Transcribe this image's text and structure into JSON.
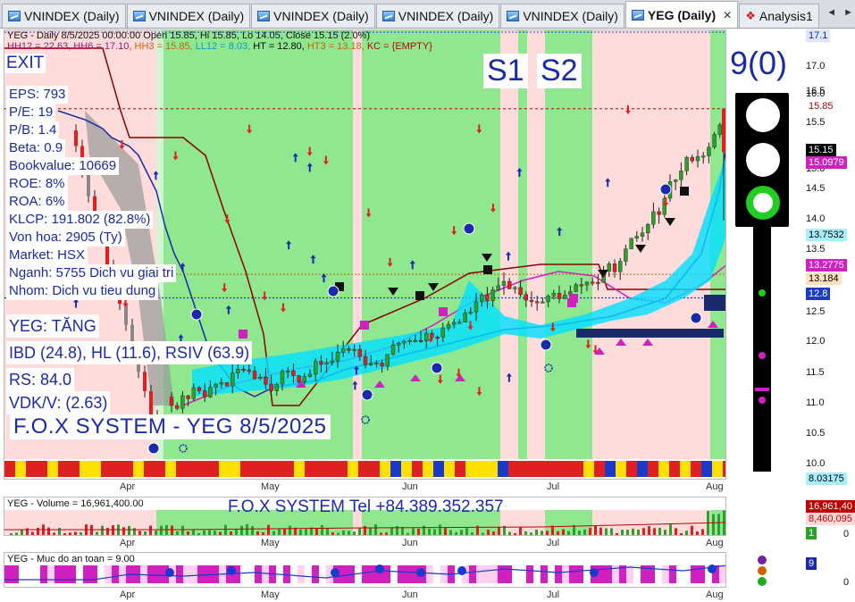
{
  "tabs": [
    {
      "label": "VNINDEX (Daily)",
      "active": false
    },
    {
      "label": "VNINDEX (Daily)",
      "active": false
    },
    {
      "label": "VNINDEX (Daily)",
      "active": false
    },
    {
      "label": "VNINDEX (Daily)",
      "active": false
    },
    {
      "label": "VNINDEX (Daily)",
      "active": false
    },
    {
      "label": "YEG (Daily)",
      "active": true
    },
    {
      "label": "Analysis1",
      "active": false
    }
  ],
  "tab_nav": {
    "left": "◄",
    "right": "►",
    "close": "✕"
  },
  "header": {
    "line1": "YEG - Daily 8/5/2025 00:00:00 Open 15.85, Hi 15.85, Lo 14.05, Close 15.15 (2.0%)",
    "hh12": "HH12 = 22.63,",
    "hh6": " HH6 = 17.10,",
    "hh3": " HH3 = 15.85,",
    "ll12": " LL12 = 8.03,",
    "ht": " HT  = 12.80,",
    "ht3": " HT3 = 13.18,",
    "kc": " KC = {EMPTY}"
  },
  "exit_label": "EXIT",
  "fundamentals": [
    "EPS: 793",
    "P/E: 19",
    "P/B: 1.4",
    "Beta: 0.9",
    "Bookvalue: 10669",
    "ROE: 8%",
    "ROA: 6%",
    "KLCP: 191.802 (82.8%)",
    "Von hoa: 2905 (Ty)",
    "Market: HSX",
    "Nganh: 5755 Dich vu giai tri",
    "Nhom: Dich vu tieu dung"
  ],
  "status": {
    "trend": "YEG: TĂNG",
    "ibd": "IBD (24.8), HL (11.6), RSIV (63.9)",
    "rs": "RS: 84.0",
    "vdk": "VDK/V:  (2.63)"
  },
  "fox_title": "F.O.X SYSTEM - YEG 8/5/2025",
  "s_labels": [
    "S1",
    "S2"
  ],
  "signal_count": "9(0)",
  "price_axis": {
    "ticks": [
      "17.0",
      "16.5",
      "16.0",
      "15.5",
      "15.0",
      "14.5",
      "14.0",
      "13.5",
      "13.0",
      "12.5",
      "12.0",
      "11.5",
      "11.0",
      "10.5",
      "10.0"
    ],
    "tags": [
      {
        "text": "17.1",
        "color": "#1a2aa8",
        "bg": "#dfe6ff"
      },
      {
        "text": "15.85",
        "color": "#c00000",
        "bg": "#ffffff"
      },
      {
        "text": "15.15",
        "color": "#ffffff",
        "bg": "#000000"
      },
      {
        "text": "15.0979",
        "color": "#ffffff",
        "bg": "#d020c0"
      },
      {
        "text": "13.7532",
        "color": "#000000",
        "bg": "#a8f0ff"
      },
      {
        "text": "13.2775",
        "color": "#ffffff",
        "bg": "#d020c0"
      },
      {
        "text": "13.184",
        "color": "#000000",
        "bg": "#ffe0c0"
      },
      {
        "text": "12.8",
        "color": "#ffffff",
        "bg": "#1a3acc"
      },
      {
        "text": "8.03175",
        "color": "#000000",
        "bg": "#a8f0ff"
      }
    ]
  },
  "x_axis": {
    "labels": [
      "Apr",
      "May",
      "Jun",
      "Jul",
      "Aug"
    ]
  },
  "volume_panel": {
    "title": "YEG - Volume = 16,961,400.00",
    "tel": "F.O.X SYSTEM Tel +84.389.352.357",
    "tags": [
      {
        "text": "16,961,40",
        "color": "#ffffff",
        "bg": "#c00000"
      },
      {
        "text": "8,460,095",
        "color": "#c00000",
        "bg": "#ffd8d8"
      },
      {
        "text": "1",
        "color": "#ffffff",
        "bg": "#2ca02c"
      }
    ],
    "zero": "0"
  },
  "safety_panel": {
    "title": "YEG - Muc do an toan = 9.00",
    "tag": "9",
    "zero": "0"
  },
  "colors": {
    "green_zone": "#8fe88f",
    "pink_zone": "#ffdcdc",
    "up_candle": "#2ca02c",
    "down_candle": "#e02020",
    "signal_blue": "#1a2aa8",
    "magenta": "#d020c0"
  }
}
